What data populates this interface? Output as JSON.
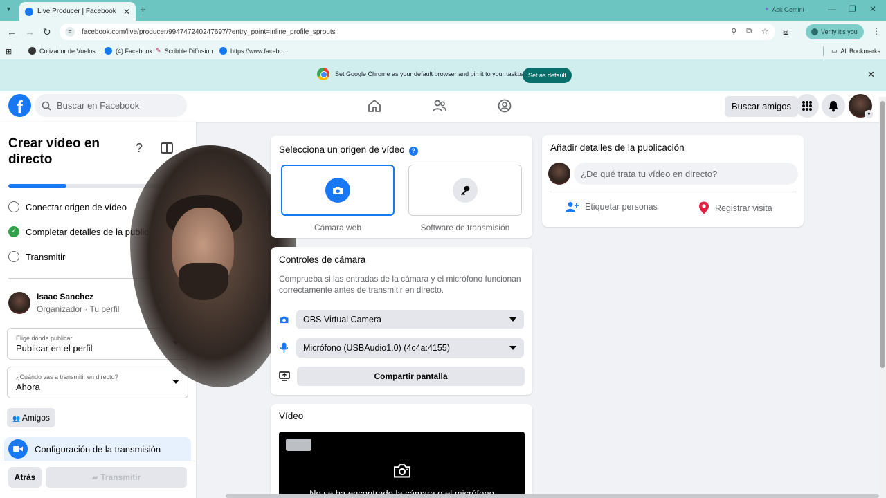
{
  "browser": {
    "tab_title": "Live Producer | Facebook",
    "tab_close": "✕",
    "new_tab": "+",
    "ask_gemini": "Ask Gemini",
    "url": "facebook.com/live/producer/994747240247697/?entry_point=inline_profile_sprouts",
    "verify_label": "Verify it's you",
    "bookmarks": [
      "Cotizador de Vuelos...",
      "(4) Facebook",
      "Scribble Diffusion",
      "https://www.facebo..."
    ],
    "all_bookmarks": "All Bookmarks",
    "infobar_text": "Set Google Chrome as your default browser and pin it to your taskbar",
    "infobar_button": "Set as default"
  },
  "header": {
    "search_placeholder": "Buscar en Facebook",
    "find_friends": "Buscar amigos"
  },
  "left": {
    "title": "Crear vídeo en directo",
    "progress": 0.33,
    "steps": [
      {
        "label": "Conectar origen de vídeo",
        "done": false
      },
      {
        "label": "Completar detalles de la publicación",
        "done": true
      },
      {
        "label": "Transmitir",
        "done": false
      }
    ],
    "organizer_name": "Isaac Sanchez",
    "organizer_sub": "Organizador · Tu perfil",
    "post_where_label": "Elige dónde publicar",
    "post_where_value": "Publicar en el perfil",
    "when_label": "¿Cuándo vas a transmitir en directo?",
    "when_value": "Ahora",
    "audience": "Amigos",
    "config_label": "Configuración de la transmisión",
    "back": "Atrás",
    "go_live": "Transmitir"
  },
  "source": {
    "title": "Selecciona un origen de vídeo",
    "help": "?",
    "options": [
      "Cámara web",
      "Software de transmisión"
    ]
  },
  "controls": {
    "title": "Controles de cámara",
    "description": "Comprueba si las entradas de la cámara y el micrófono funcionan correctamente antes de transmitir en directo.",
    "camera": "OBS Virtual Camera",
    "microphone": "Micrófono (USBAudio1.0) (4c4a:4155)",
    "share_screen": "Compartir pantalla"
  },
  "video": {
    "title": "Vídeo",
    "message": "No se ha encontrado la cámara o el micrófono"
  },
  "details": {
    "title": "Añadir detalles de la publicación",
    "placeholder": "¿De qué trata tu vídeo en directo?",
    "tag_people": "Etiquetar personas",
    "check_in": "Registrar visita"
  },
  "colors": {
    "accent": "#1877f2",
    "success": "#31a24c",
    "location": "#e41e3f",
    "chrome_teal": "#6cc5c1"
  }
}
